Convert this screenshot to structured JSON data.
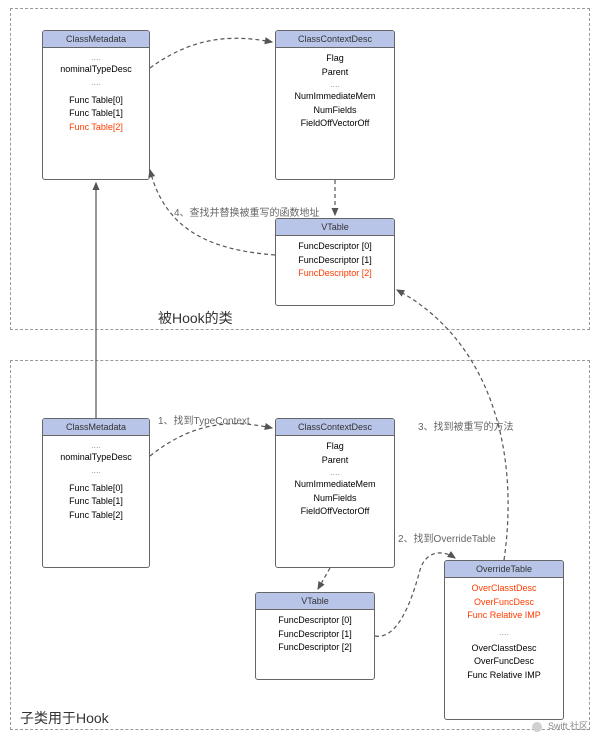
{
  "diagram": {
    "top_container_label": "被Hook的类",
    "bottom_container_label": "子类用于Hook",
    "top": {
      "class_metadata": {
        "title": "ClassMetadata",
        "nominal": "nominalTypeDesc",
        "func0": "Func Table[0]",
        "func1": "Func Table[1]",
        "func2": "Func Table[2]"
      },
      "class_context_desc": {
        "title": "ClassContextDesc",
        "flag": "Flag",
        "parent": "Parent",
        "num_immediate": "NumImmediateMem",
        "num_fields": "NumFields",
        "field_off": "FieldOffVectorOff"
      },
      "vtable": {
        "title": "VTable",
        "fd0": "FuncDescriptor [0]",
        "fd1": "FuncDescriptor [1]",
        "fd2": "FuncDescriptor [2]"
      }
    },
    "bottom": {
      "class_metadata": {
        "title": "ClassMetadata",
        "nominal": "nominalTypeDesc",
        "func0": "Func Table[0]",
        "func1": "Func Table[1]",
        "func2": "Func Table[2]"
      },
      "class_context_desc": {
        "title": "ClassContextDesc",
        "flag": "Flag",
        "parent": "Parent",
        "num_immediate": "NumImmediateMem",
        "num_fields": "NumFields",
        "field_off": "FieldOffVectorOff"
      },
      "vtable": {
        "title": "VTable",
        "fd0": "FuncDescriptor [0]",
        "fd1": "FuncDescriptor [1]",
        "fd2": "FuncDescriptor [2]"
      },
      "override_table": {
        "title": "OverrideTable",
        "over_class_desc_hi": "OverClasstDesc",
        "over_func_desc_hi": "OverFuncDesc",
        "func_relative_imp_hi": "Func Relative IMP",
        "over_class_desc": "OverClasstDesc",
        "over_func_desc": "OverFuncDesc",
        "func_relative_imp": "Func Relative IMP"
      }
    },
    "annotations": {
      "a1": "1、找到TypeContext",
      "a2": "2、找到OverrideTable",
      "a3": "3、找到被重写的方法",
      "a4": "4、查找并替换被重写的函数地址"
    },
    "footer": "Swift 社区"
  }
}
